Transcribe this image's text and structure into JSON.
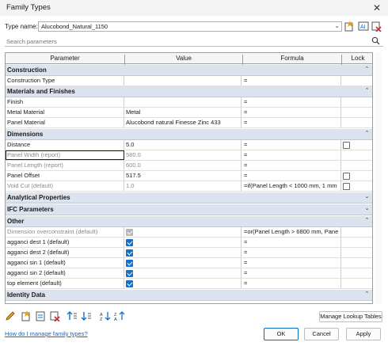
{
  "window": {
    "title": "Family Types"
  },
  "type_name": {
    "label": "Type name:",
    "value": "Alucobond_Natural_1150"
  },
  "search": {
    "placeholder": "Search parameters"
  },
  "columns": {
    "parameter": "Parameter",
    "value": "Value",
    "formula": "Formula",
    "lock": "Lock"
  },
  "groups": [
    {
      "title": "Construction",
      "rows": [
        {
          "parameter": "Construction Type",
          "value": "",
          "formula": "="
        }
      ]
    },
    {
      "title": "Materials and Finishes",
      "rows": [
        {
          "parameter": "Finish",
          "value": "",
          "formula": "="
        },
        {
          "parameter": "Metal Material",
          "value": "Metal",
          "formula": "="
        },
        {
          "parameter": "Panel Material",
          "value": "Alucobond natural Finesse Zinc 433",
          "formula": "="
        }
      ]
    },
    {
      "title": "Dimensions",
      "rows": [
        {
          "parameter": "Distance",
          "value": "5.0",
          "formula": "=",
          "lock": false
        },
        {
          "parameter": "Panel Width (report)",
          "value": "580.0",
          "formula": "="
        },
        {
          "parameter": "Panel Length (report)",
          "value": "600.0",
          "formula": "="
        },
        {
          "parameter": "Panel Offset",
          "value": "517.5",
          "formula": "=",
          "lock": false
        },
        {
          "parameter": "Void Cut (default)",
          "value": "1.0",
          "formula": "=if(Panel Length < 1000 mm, 1 mm",
          "lock": false
        }
      ]
    },
    {
      "title": "Analytical Properties"
    },
    {
      "title": "IFC Parameters"
    },
    {
      "title": "Other",
      "rows": [
        {
          "parameter": "Dimension overconstraint (default)",
          "value_check": true,
          "formula": "=or(Panel Length > 6800 mm, Pane"
        },
        {
          "parameter": "agganci dest 1 (default)",
          "value_check": true,
          "formula": "="
        },
        {
          "parameter": "agganci dest 2 (default)",
          "value_check": true,
          "formula": "="
        },
        {
          "parameter": "agganci sin 1 (default)",
          "value_check": true,
          "formula": "="
        },
        {
          "parameter": "agganci sin 2 (default)",
          "value_check": true,
          "formula": "="
        },
        {
          "parameter": "top element (default)",
          "value_check": true,
          "formula": "="
        }
      ]
    },
    {
      "title": "Identity Data"
    }
  ],
  "buttons": {
    "lookup_tables": "Manage Lookup Tables",
    "ok": "OK",
    "cancel": "Cancel",
    "apply": "Apply"
  },
  "help_link": "How do I manage family types?",
  "icons": {
    "tools": [
      "pencil-icon",
      "new-type-icon",
      "rename-type-icon",
      "delete-type-icon",
      "new-parameter-icon",
      "modify-parameter-icon",
      "move-up-icon",
      "move-down-icon",
      "sort-ascending-icon",
      "sort-descending-icon"
    ],
    "type_tools": [
      "new-type-icon",
      "rename-type-icon",
      "delete-type-icon"
    ]
  },
  "colors": {
    "section_bg": "#dce3ee",
    "accent": "#1670c8",
    "link": "#2064b4"
  }
}
